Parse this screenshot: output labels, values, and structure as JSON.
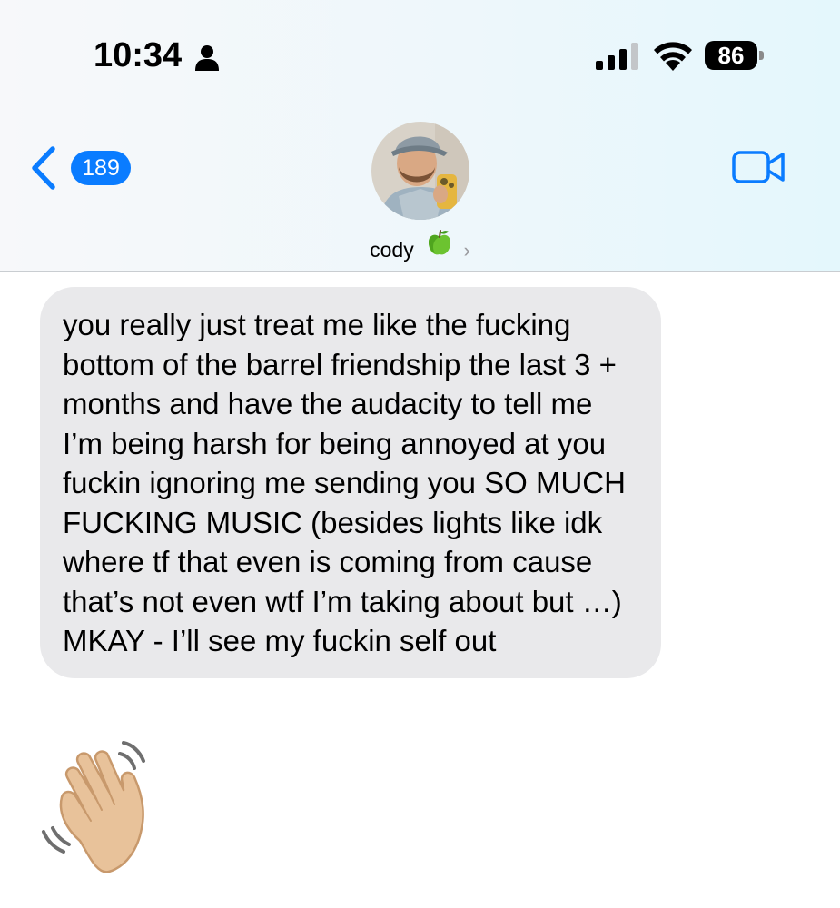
{
  "status_bar": {
    "time": "10:34",
    "battery_level": "86",
    "person_icon": "person-icon",
    "signal_icon": "cellular-signal-icon",
    "wifi_icon": "wifi-icon"
  },
  "nav": {
    "back_count": "189",
    "back_icon": "chevron-left-icon",
    "video_icon": "video-camera-icon",
    "contact_name": "cody",
    "contact_emoji": "green-apple-icon",
    "accent_color": "#0a7cff"
  },
  "messages": [
    {
      "direction": "incoming",
      "text": "you really just treat me like the fucking bottom of the barrel friendship the last 3 + months and have the audacity to tell me I’m being harsh for being annoyed at you fuckin ignoring me sending you SO MUCH FUCKING MUSIC (besides lights like idk where tf that even is coming from cause that’s not even wtf I’m taking about but …) MKAY - I’ll see my fuckin self out"
    },
    {
      "direction": "incoming",
      "emoji": "waving-hand-icon"
    }
  ],
  "colors": {
    "incoming_bubble": "#e9e9eb",
    "header_background": "#eef7fb"
  }
}
